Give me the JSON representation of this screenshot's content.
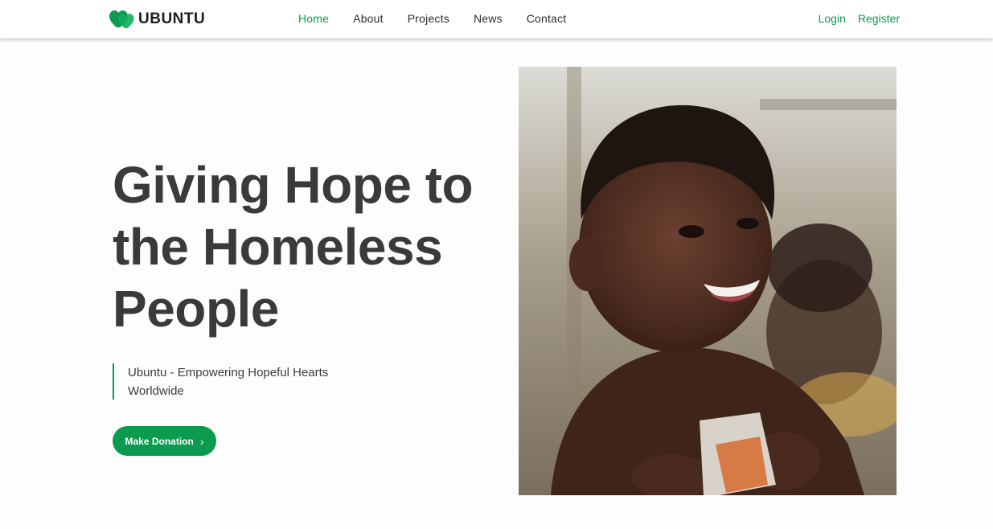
{
  "brand": {
    "name": "UBUNTU",
    "logo_icon": "hearts-icon",
    "accent_color": "#0a9b4f"
  },
  "nav": {
    "items": [
      {
        "label": "Home",
        "active": true
      },
      {
        "label": "About",
        "active": false
      },
      {
        "label": "Projects",
        "active": false
      },
      {
        "label": "News",
        "active": false
      },
      {
        "label": "Contact",
        "active": false
      }
    ]
  },
  "auth": {
    "login": "Login",
    "register": "Register"
  },
  "hero": {
    "title_lines": [
      "Giving Hope to",
      "the Homeless",
      "People"
    ],
    "tagline_lines": [
      "Ubuntu - Empowering Hopeful Hearts",
      "Worldwide"
    ],
    "cta_label": "Make Donation",
    "cta_icon": "chevron-right-icon"
  }
}
